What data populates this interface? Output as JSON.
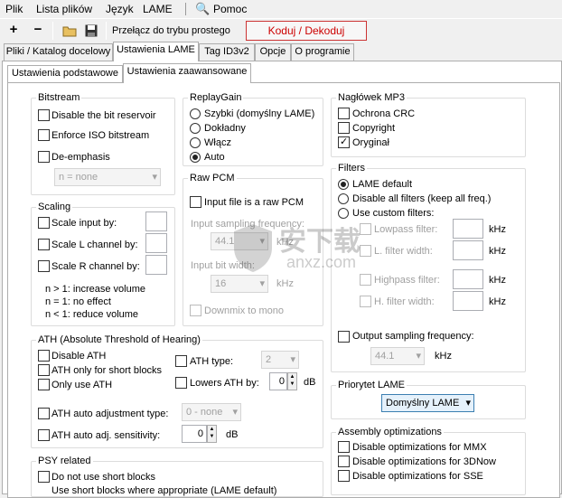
{
  "menu": {
    "plik": "Plik",
    "lista": "Lista plików",
    "jezyk": "Język",
    "lame": "LAME",
    "pomoc": "Pomoc"
  },
  "toolbar": {
    "add": "+",
    "remove": "−",
    "simple_mode": "Przełącz do trybu prostego",
    "encode": "Koduj / Dekoduj"
  },
  "tabs": [
    "Pliki / Katalog docelowy",
    "Ustawienia LAME",
    "Tag ID3v2",
    "Opcje",
    "O programie"
  ],
  "subtabs": [
    "Ustawienia podstawowe",
    "Ustawienia zaawansowane"
  ],
  "bitstream": {
    "title": "Bitstream",
    "disable_reservoir": "Disable the bit reservoir",
    "enforce_iso": "Enforce ISO bitstream",
    "deemphasis": "De-emphasis",
    "deemph_value": "n = none"
  },
  "scaling": {
    "title": "Scaling",
    "input": "Scale input by:",
    "l": "Scale L channel by:",
    "r": "Scale R channel by:",
    "note1": "n > 1: increase volume",
    "note2": "n = 1: no effect",
    "note3": "n < 1: reduce volume"
  },
  "replaygain": {
    "title": "ReplayGain",
    "fast": "Szybki (domyślny LAME)",
    "accurate": "Dokładny",
    "on": "Włącz",
    "auto": "Auto"
  },
  "rawpcm": {
    "title": "Raw PCM",
    "is_raw": "Input file is a raw PCM",
    "freq_label": "Input sampling frequency:",
    "freq_value": "44.1",
    "khz": "kHz",
    "bitwidth_label": "Input bit width:",
    "bitwidth_value": "16",
    "bits": "kHz",
    "downmix": "Downmix to mono"
  },
  "header": {
    "title": "Nagłówek MP3",
    "crc": "Ochrona CRC",
    "copyright": "Copyright",
    "original": "Oryginał"
  },
  "filters": {
    "title": "Filters",
    "lame_default": "LAME default",
    "disable_all": "Disable all filters (keep all freq.)",
    "custom": "Use custom filters:",
    "lowpass": "Lowpass filter:",
    "lp_width": "L. filter width:",
    "highpass": "Highpass filter:",
    "hp_width": "H. filter width:",
    "khz": "kHz",
    "out_freq": "Output sampling frequency:",
    "out_value": "44.1"
  },
  "ath": {
    "title": "ATH (Absolute Threshold of Hearing)",
    "disable": "Disable ATH",
    "short": "ATH only for short blocks",
    "only": "Only use ATH",
    "type": "ATH type:",
    "type_value": "2",
    "lowers": "Lowers ATH by:",
    "lowers_value": "0",
    "db": "dB",
    "auto_adj": "ATH auto adjustment type:",
    "auto_adj_value": "0 - none",
    "auto_sens": "ATH auto adj. sensitivity:",
    "auto_sens_value": "0"
  },
  "psy": {
    "title": "PSY related",
    "no_short": "Do not use short blocks",
    "cut": "Use short blocks where appropriate (LAME default)"
  },
  "priority": {
    "title": "Priorytet LAME",
    "value": "Domyślny LAME"
  },
  "asm": {
    "title": "Assembly optimizations",
    "mmx": "Disable optimizations for MMX",
    "now3d": "Disable optimizations for 3DNow",
    "sse": "Disable optimizations for SSE"
  },
  "watermark": {
    "text": "安下载",
    "sub": "anxz.com"
  }
}
